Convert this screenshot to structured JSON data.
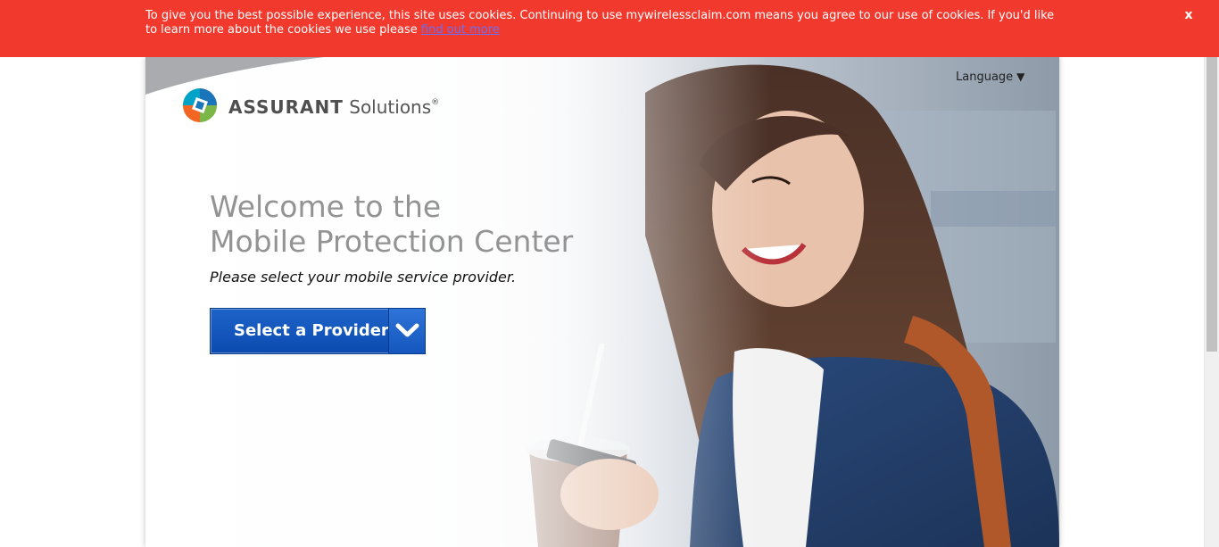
{
  "cookie_banner": {
    "text": "To give you the best possible experience, this site uses cookies. Continuing to use mywirelessclaim.com means you agree to our use of cookies. If you'd like to learn more about the cookies we use please ",
    "link_label": "find out more",
    "close_label": "x"
  },
  "header": {
    "logo_brand": "ASSURANT",
    "logo_sub": "Solutions",
    "logo_reg": "®",
    "language_label": "Language",
    "language_caret": "▼"
  },
  "hero": {
    "headline_line1": "Welcome to the",
    "headline_line2": "Mobile Protection Center",
    "subhead": "Please select your mobile service provider.",
    "provider_button_label": "Select a Provider"
  },
  "colors": {
    "banner": "#f1392e",
    "button_blue": "#0b4bb0",
    "headline_gray": "#939393"
  },
  "icons": {
    "logo": "assurant-logo-icon",
    "dropdown": "chevron-down-icon",
    "close": "close-icon"
  }
}
